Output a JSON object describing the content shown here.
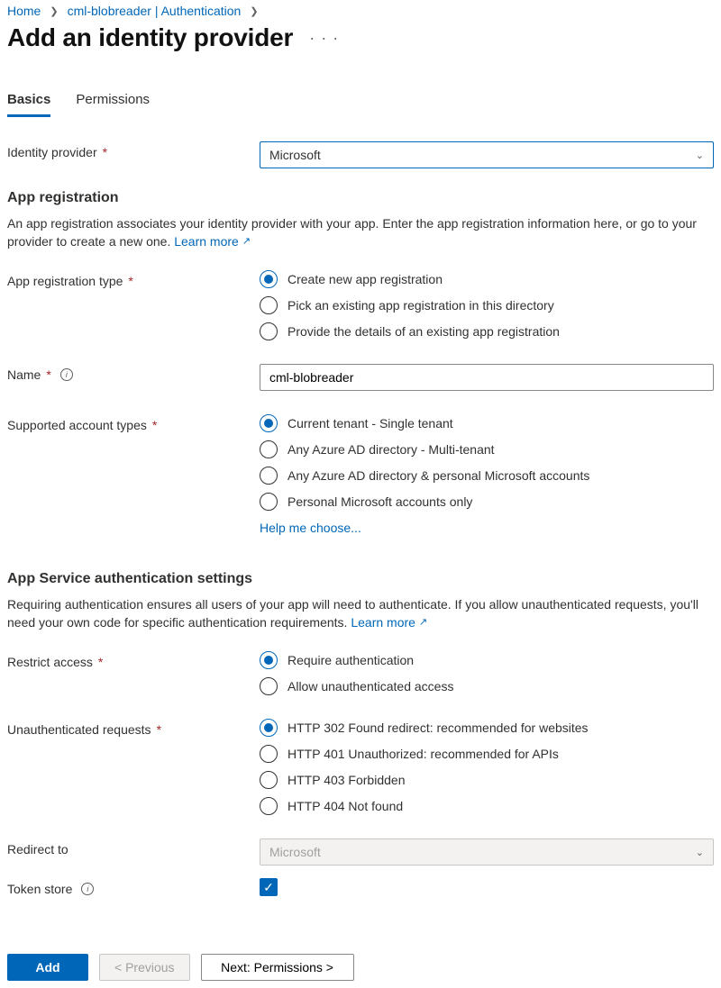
{
  "breadcrumb": {
    "home": "Home",
    "parent": "cml-blobreader | Authentication"
  },
  "page_title": "Add an identity provider",
  "tabs": {
    "basics": "Basics",
    "permissions": "Permissions"
  },
  "fields": {
    "identity_provider_label": "Identity provider",
    "identity_provider_value": "Microsoft",
    "app_reg_type_label": "App registration type",
    "app_reg_type_options": {
      "create": "Create new app registration",
      "pick": "Pick an existing app registration in this directory",
      "provide": "Provide the details of an existing app registration"
    },
    "name_label": "Name",
    "name_value": "cml-blobreader",
    "account_types_label": "Supported account types",
    "account_types_options": {
      "single": "Current tenant - Single tenant",
      "multi": "Any Azure AD directory - Multi-tenant",
      "multi_personal": "Any Azure AD directory & personal Microsoft accounts",
      "personal": "Personal Microsoft accounts only"
    },
    "help_me_choose": "Help me choose...",
    "restrict_access_label": "Restrict access",
    "restrict_access_options": {
      "require": "Require authentication",
      "allow": "Allow unauthenticated access"
    },
    "unauth_requests_label": "Unauthenticated requests",
    "unauth_options": {
      "302": "HTTP 302 Found redirect: recommended for websites",
      "401": "HTTP 401 Unauthorized: recommended for APIs",
      "403": "HTTP 403 Forbidden",
      "404": "HTTP 404 Not found"
    },
    "redirect_to_label": "Redirect to",
    "redirect_to_value": "Microsoft",
    "token_store_label": "Token store"
  },
  "sections": {
    "app_reg_heading": "App registration",
    "app_reg_desc": "An app registration associates your identity provider with your app. Enter the app registration information here, or go to your provider to create a new one.",
    "auth_settings_heading": "App Service authentication settings",
    "auth_settings_desc": "Requiring authentication ensures all users of your app will need to authenticate. If you allow unauthenticated requests, you'll need your own code for specific authentication requirements."
  },
  "links": {
    "learn_more": "Learn more"
  },
  "footer": {
    "add": "Add",
    "previous": "<  Previous",
    "next": "Next: Permissions  >"
  }
}
